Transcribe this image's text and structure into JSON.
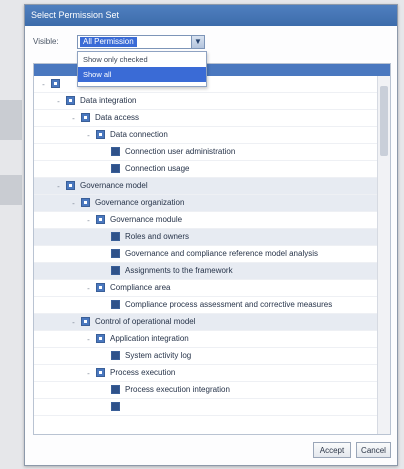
{
  "dialog": {
    "title": "Select Permission Set",
    "visible_label": "Visible:",
    "combo_value": "All Permission",
    "dropdown_options": [
      "Show only checked",
      "Show all"
    ],
    "selected_option_index": 1
  },
  "tree": {
    "rows": [
      {
        "depth": 0,
        "expander": "-",
        "label": "",
        "shaded": false
      },
      {
        "depth": 1,
        "expander": "-",
        "label": "Data integration",
        "shaded": false
      },
      {
        "depth": 2,
        "expander": "-",
        "label": "Data access",
        "shaded": false
      },
      {
        "depth": 3,
        "expander": "-",
        "label": "Data connection",
        "shaded": false
      },
      {
        "depth": 4,
        "expander": "",
        "label": "Connection user administration",
        "shaded": false
      },
      {
        "depth": 4,
        "expander": "",
        "label": "Connection usage",
        "shaded": false
      },
      {
        "depth": 1,
        "expander": "-",
        "label": "Governance model",
        "shaded": true
      },
      {
        "depth": 2,
        "expander": "-",
        "label": "Governance organization",
        "shaded": true
      },
      {
        "depth": 3,
        "expander": "-",
        "label": "Governance module",
        "shaded": false
      },
      {
        "depth": 4,
        "expander": "",
        "label": "Roles and owners",
        "shaded": true
      },
      {
        "depth": 4,
        "expander": "",
        "label": "Governance and compliance reference model analysis",
        "shaded": false
      },
      {
        "depth": 4,
        "expander": "",
        "label": "Assignments to the framework",
        "shaded": true
      },
      {
        "depth": 3,
        "expander": "-",
        "label": "Compliance area",
        "shaded": false
      },
      {
        "depth": 4,
        "expander": "",
        "label": "Compliance process assessment and corrective measures",
        "shaded": false
      },
      {
        "depth": 2,
        "expander": "-",
        "label": "Control of operational model",
        "shaded": true
      },
      {
        "depth": 3,
        "expander": "-",
        "label": "Application integration",
        "shaded": false
      },
      {
        "depth": 4,
        "expander": "",
        "label": "System activity log",
        "shaded": false
      },
      {
        "depth": 3,
        "expander": "-",
        "label": "Process execution",
        "shaded": false
      },
      {
        "depth": 4,
        "expander": "",
        "label": "Process execution integration",
        "shaded": false
      },
      {
        "depth": 4,
        "expander": "",
        "label": "",
        "shaded": false
      }
    ]
  },
  "buttons": {
    "ok_label": "Accept",
    "cancel_label": "Cancel"
  }
}
